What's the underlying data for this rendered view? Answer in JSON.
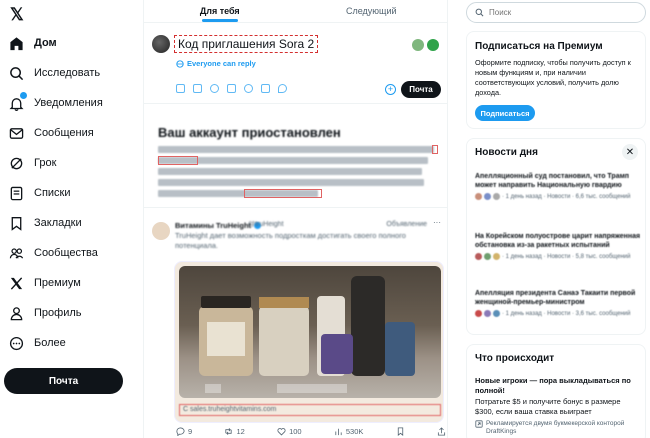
{
  "nav": {
    "logo": "𝕏",
    "items": [
      {
        "label": "Дом",
        "icon": "home-icon",
        "bold": true
      },
      {
        "label": "Исследовать",
        "icon": "search-icon"
      },
      {
        "label": "Уведомления",
        "icon": "bell-icon"
      },
      {
        "label": "Сообщения",
        "icon": "mail-icon"
      },
      {
        "label": "Грок",
        "icon": "grok-icon"
      },
      {
        "label": "Списки",
        "icon": "list-icon"
      },
      {
        "label": "Закладки",
        "icon": "bookmark-icon"
      },
      {
        "label": "Сообщества",
        "icon": "people-icon"
      },
      {
        "label": "Премиум",
        "icon": "x-icon"
      },
      {
        "label": "Профиль",
        "icon": "person-icon"
      },
      {
        "label": "Более",
        "icon": "more-circle-icon"
      }
    ],
    "post_label": "Почта"
  },
  "main": {
    "tabs": [
      {
        "label": "Для тебя",
        "active": true
      },
      {
        "label": "Следующий",
        "active": false
      }
    ],
    "compose": {
      "input_value": "Код приглашения Sora 2",
      "everyone_label": "Everyone can reply",
      "post_label": "Почта",
      "plus_label": "+"
    },
    "suspended": {
      "title": "Ваш аккаунт приостановлен"
    },
    "tweet": {
      "author": "Витамины TruHeight",
      "handle": "@truHeight",
      "ad_label": "Объявление",
      "more": "···",
      "text": "TruHeight дает возможность подросткам достигать своего полного потенциала.",
      "url": "С sales.truheightvitamins.com",
      "actions": {
        "replies": "9",
        "retweets": "12",
        "likes": "100",
        "views": "530K"
      }
    }
  },
  "right": {
    "search_placeholder": "Поиск",
    "premium": {
      "title": "Подписаться на Премиум",
      "text": "Оформите подписку, чтобы получить доступ к новым функциям и, при наличии соответствующих условий, получить долю дохода.",
      "button": "Подписаться"
    },
    "news": {
      "title": "Новости дня",
      "close": "✕",
      "items": [
        {
          "headline": "Апелляционный суд постановил, что Трамп может направить Национальную гвардию",
          "meta": "· 1 день назад · Новости · 6,6 тыс. сообщений"
        },
        {
          "headline": "На Корейском полуострове царит напряженная обстановка из-за ракетных испытаний",
          "meta": "· 1 день назад · Новости · 5,8 тыс. сообщений"
        },
        {
          "headline": "Апелляция президента Санаэ Такаити первой женщиной-премьер-министром",
          "meta": "· 1 день назад · Новости · 3,6 тыс. сообщений"
        }
      ]
    },
    "happening": {
      "title": "Что происходит",
      "headline": "Новые игроки — пора выкладываться по полной!",
      "desc": "Потратьте $5 и получите бонус в размере $300, если ваша ставка выиграет",
      "promo": "Рекламируется двумя букмекерской конторой DraftKings"
    }
  },
  "colors": {
    "accent": "#1d9bf0",
    "text": "#0f1419",
    "muted": "#536471",
    "border": "#eff3f4",
    "highlight": "#d32f2f"
  }
}
